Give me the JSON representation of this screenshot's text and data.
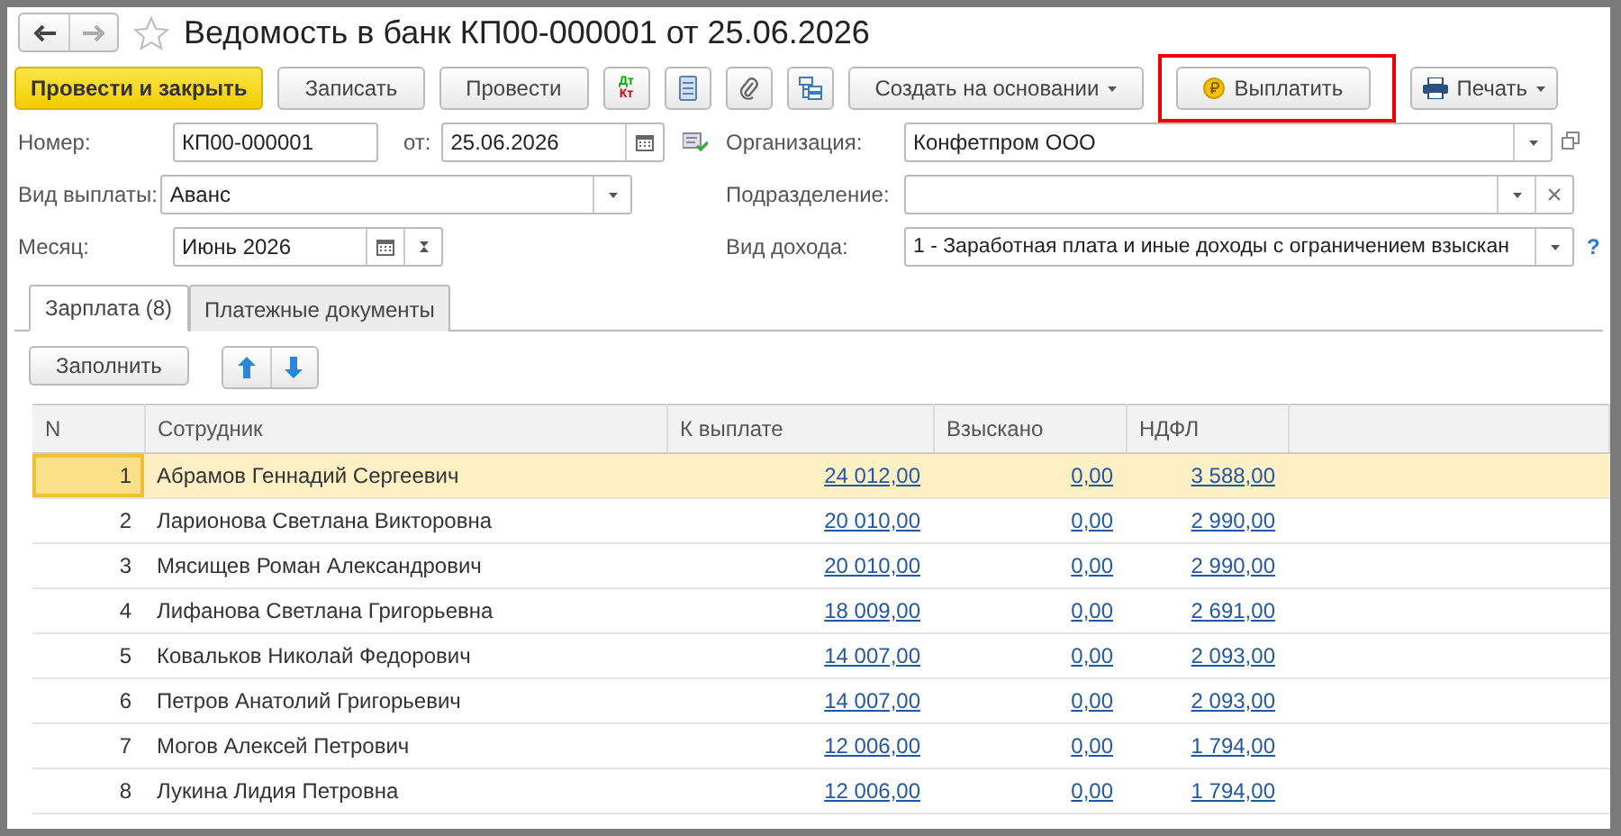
{
  "window": {
    "title": "Ведомость в банк КП00-000001 от 25.06.2026",
    "favorite": false
  },
  "toolbar": {
    "buttons": [
      {
        "kind": "primary",
        "label": "Провести и закрыть"
      },
      {
        "kind": "text",
        "label": "Записать"
      },
      {
        "kind": "text",
        "label": "Провести"
      },
      {
        "kind": "dtkt",
        "label": "Дт"
      },
      {
        "kind": "list"
      },
      {
        "kind": "clip"
      },
      {
        "kind": "struct"
      },
      {
        "kind": "menu",
        "label": "Создать на основании"
      },
      {
        "kind": "pay",
        "label": "Выплатить",
        "highlighted": true
      },
      {
        "kind": "print",
        "label": "Печать"
      }
    ],
    "dtkt_sub": "Кт"
  },
  "form": {
    "number": {
      "label": "Номер:",
      "value": "КП00-000001"
    },
    "date": {
      "label": "от:",
      "value": "25.06.2026"
    },
    "payment_type": {
      "label": "Вид выплаты:",
      "value": "Аванс"
    },
    "month": {
      "label": "Месяц:",
      "value": "Июнь 2026"
    },
    "organization": {
      "label": "Организация:",
      "value": "Конфетпром ООО"
    },
    "department": {
      "label": "Подразделение:"
    },
    "income_type": {
      "label": "Вид дохода:",
      "value": "1 - Заработная плата и иные доходы с ограничением взыскан",
      "help": "?"
    }
  },
  "tabs": [
    {
      "label": "Зарплата (8)",
      "selected": true
    },
    {
      "label": "Платежные документы",
      "selected": false
    }
  ],
  "table_toolbar": {
    "fill": "Заполнить"
  },
  "table": {
    "columns": [
      "N",
      "Сотрудник",
      "К выплате",
      "Взыскано",
      "НДФЛ"
    ],
    "rows": [
      {
        "n": "1",
        "employee": "Абрамов Геннадий Сергеевич",
        "pay": "24 012,00",
        "withheld": "0,00",
        "ndfl": "3 588,00",
        "selected": true
      },
      {
        "n": "2",
        "employee": "Ларионова Светлана Викторовна",
        "pay": "20 010,00",
        "withheld": "0,00",
        "ndfl": "2 990,00",
        "selected": false
      },
      {
        "n": "3",
        "employee": "Мясищев Роман Александрович",
        "pay": "20 010,00",
        "withheld": "0,00",
        "ndfl": "2 990,00",
        "selected": false
      },
      {
        "n": "4",
        "employee": "Лифанова Светлана Григорьевна",
        "pay": "18 009,00",
        "withheld": "0,00",
        "ndfl": "2 691,00",
        "selected": false
      },
      {
        "n": "5",
        "employee": "Ковальков Николай Федорович",
        "pay": "14 007,00",
        "withheld": "0,00",
        "ndfl": "2 093,00",
        "selected": false
      },
      {
        "n": "6",
        "employee": "Петров Анатолий Григорьевич",
        "pay": "14 007,00",
        "withheld": "0,00",
        "ndfl": "2 093,00",
        "selected": false
      },
      {
        "n": "7",
        "employee": "Могов Алексей Петрович",
        "pay": "12 006,00",
        "withheld": "0,00",
        "ndfl": "1 794,00",
        "selected": false
      },
      {
        "n": "8",
        "employee": "Лукина Лидия Петровна",
        "pay": "12 006,00",
        "withheld": "0,00",
        "ndfl": "1 794,00",
        "selected": false
      }
    ]
  }
}
